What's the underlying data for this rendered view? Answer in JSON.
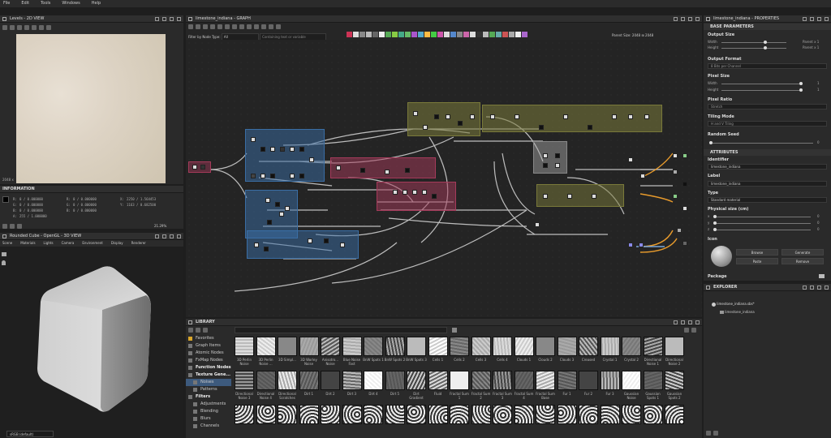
{
  "menu": [
    "File",
    "Edit",
    "Tools",
    "Windows",
    "Help"
  ],
  "view2d": {
    "title": "Levels - 2D VIEW",
    "size_label": "2048 x",
    "zoom": "21.29%"
  },
  "info": {
    "title": "INFORMATION",
    "rows": [
      {
        "a": "R:",
        "b": "0 / 0.000000",
        "c": "R:",
        "d": "0 / 0.000000",
        "e": "X:",
        "f": "2250 / 1.564453"
      },
      {
        "a": "G:",
        "b": "0 / 0.000000",
        "c": "G:",
        "d": "0 / 0.000000",
        "e": "Y:",
        "f": "1163 / 0.682500"
      },
      {
        "a": "B:",
        "b": "0 / 0.000000",
        "c": "B:",
        "d": "0 / 0.000000",
        "e": "",
        "f": ""
      },
      {
        "a": "A:",
        "b": "255 / 1.000000",
        "c": "",
        "d": "",
        "e": "",
        "f": ""
      }
    ]
  },
  "view3d": {
    "title": "Rounded Cube - OpenGL - 3D VIEW",
    "menu": [
      "Scene",
      "Materials",
      "Lights",
      "Camera",
      "Environment",
      "Display",
      "Renderer"
    ],
    "bottom_select": "sRGB (default)"
  },
  "graph": {
    "title": "limestone_indiana - GRAPH",
    "filter_label": "Filter by Node Type:",
    "filter_value": "All",
    "search_placeholder": "Containing text or variable",
    "parent_size_label": "Parent Size:",
    "parent_size_value": "2048",
    "size_value": "2048",
    "frame_titles": [
      "",
      "",
      "",
      "",
      "",
      "",
      "",
      ""
    ]
  },
  "library": {
    "title": "LIBRARY",
    "tree": [
      {
        "label": "Favorites",
        "level": 0,
        "bold": false,
        "sel": false
      },
      {
        "label": "Graph Items",
        "level": 0,
        "bold": false,
        "sel": false
      },
      {
        "label": "Atomic Nodes",
        "level": 0,
        "bold": false,
        "sel": false
      },
      {
        "label": "FxMap Nodes",
        "level": 0,
        "bold": false,
        "sel": false
      },
      {
        "label": "Function Nodes",
        "level": 0,
        "bold": true,
        "sel": false
      },
      {
        "label": "Texture Gene...",
        "level": 0,
        "bold": true,
        "sel": false
      },
      {
        "label": "Noises",
        "level": 1,
        "bold": false,
        "sel": true
      },
      {
        "label": "Patterns",
        "level": 1,
        "bold": false,
        "sel": false
      },
      {
        "label": "Filters",
        "level": 0,
        "bold": true,
        "sel": false
      },
      {
        "label": "Adjustments",
        "level": 1,
        "bold": false,
        "sel": false
      },
      {
        "label": "Blending",
        "level": 1,
        "bold": false,
        "sel": false
      },
      {
        "label": "Blurs",
        "level": 1,
        "bold": false,
        "sel": false
      },
      {
        "label": "Channels",
        "level": 1,
        "bold": false,
        "sel": false
      }
    ],
    "row1": [
      "3D Perlin Noise",
      "3D Perlin Noise ...",
      "3D Simpl...",
      "3D Worley Noise",
      "Anisotro... Noise",
      "Blue Noise Fast",
      "BnW Spots 1",
      "BnW Spots 2",
      "BnW Spots 3",
      "Cells 1",
      "Cells 2",
      "Cells 3",
      "Cells 4",
      "Clouds 1",
      "Clouds 2",
      "Clouds 3",
      "Creased",
      "Crystal 1",
      "Crystal 2",
      "Directional Noise 1",
      "Directional Noise 2"
    ],
    "row2": [
      "Directional Noise 3",
      "Directional Noise 4",
      "Directional Scratches",
      "Dirt 1",
      "Dirt 2",
      "Dirt 3",
      "Dirt 4",
      "Dirt 5",
      "Dirt Gradient",
      "Fluid",
      "Fractal Sum 1",
      "Fractal Sum 2",
      "Fractal Sum 3",
      "Fractal Sum 4",
      "Fractal Sum Base",
      "Fur 1",
      "Fur 2",
      "Fur 3",
      "Gaussian Noise",
      "Gaussian Spots 1",
      "Gaussian Spots 2"
    ]
  },
  "properties": {
    "title": "limestone_indiana - PROPERTIES",
    "base_header": "BASE PARAMETERS",
    "output_size": "Output Size",
    "width_label": "Width",
    "height_label": "Height",
    "parent_x1": "Parent x 1",
    "output_format": "Output Format",
    "output_format_value": "8 Bits per Channel",
    "pixel_size": "Pixel Size",
    "pixel_ratio": "Pixel Ratio",
    "pixel_ratio_value": "Stretch",
    "tiling_mode": "Tiling Mode",
    "tiling_value": "H and V Tiling",
    "random_seed": "Random Seed",
    "random_value": "0",
    "attributes_header": "ATTRIBUTES",
    "identifier": "Identifier",
    "identifier_value": "limestone_indiana",
    "label": "Label",
    "label_value": "limestone_indiana",
    "type": "Type",
    "type_value": "Standard material",
    "physical_size": "Physical size (cm)",
    "xyz": [
      "x",
      "y",
      "z"
    ],
    "xyz_values": [
      "0",
      "0",
      "0"
    ],
    "icon": "Icon",
    "browse": "Browse",
    "generate": "Generate",
    "paste": "Paste",
    "remove": "Remove",
    "package": "Package",
    "one": "1"
  },
  "explorer": {
    "title": "EXPLORER",
    "package": "limestone_indiana.sbs*",
    "graph": "limestone_indiana"
  },
  "colors": {
    "accent": "#3d5a7d",
    "frame_blue": "#3a6ea5",
    "frame_red": "#a53a5a",
    "frame_olive": "#7a7a3a"
  }
}
